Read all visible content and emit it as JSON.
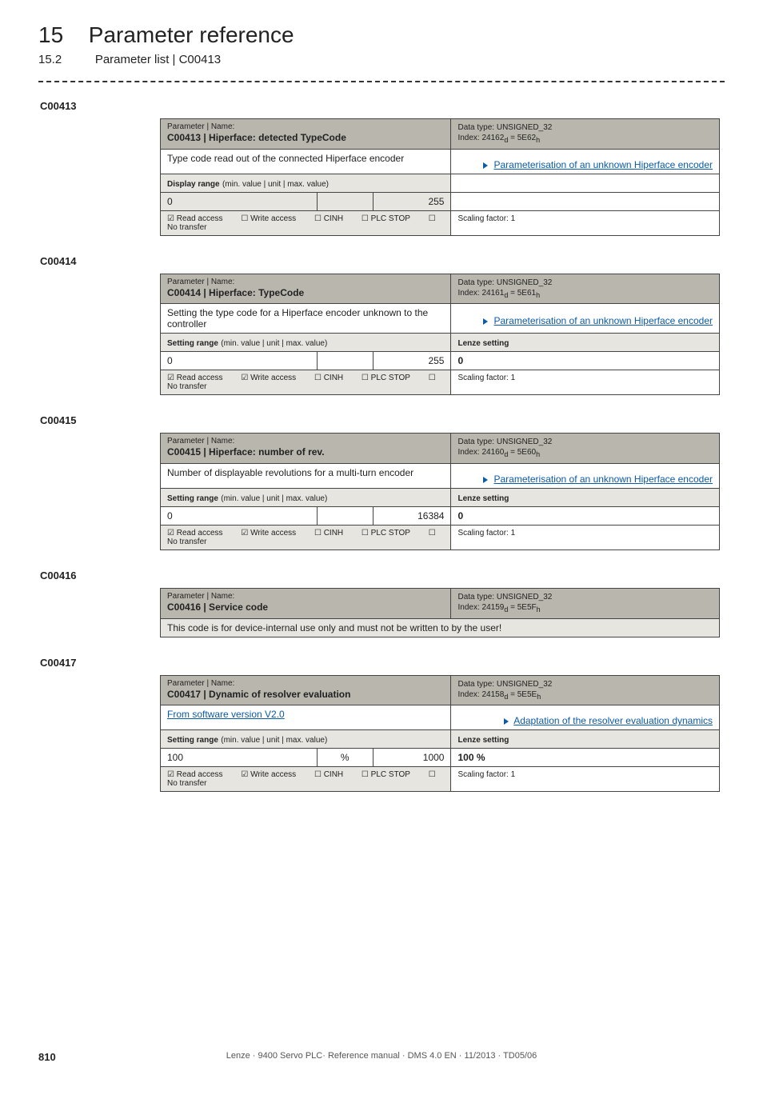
{
  "chapter": {
    "number": "15",
    "title": "Parameter reference"
  },
  "section": {
    "number": "15.2",
    "title": "Parameter list | C00413"
  },
  "labels": {
    "parameter_name": "Parameter | Name:",
    "data_type": "Data type:",
    "index": "Index:",
    "display_range": "Display range",
    "setting_range": "Setting range",
    "range_suffix": "(min. value | unit | max. value)",
    "lenze_setting": "Lenze setting",
    "scaling_factor": "Scaling factor:",
    "read_access": "Read access",
    "write_access": "Write access",
    "cinh": "CINH",
    "plc_stop": "PLC STOP",
    "no_transfer": "No transfer"
  },
  "params": [
    {
      "code": "C00413",
      "title": "C00413 | Hiperface: detected TypeCode",
      "data_type": "UNSIGNED_32",
      "index": "24162",
      "index_hex": "5E62",
      "description": "Type code read out of the connected Hiperface encoder",
      "link_text": "Parameterisation of an unknown Hiperface encoder",
      "range_kind": "display",
      "range": {
        "min": "0",
        "unit": "",
        "max": "255"
      },
      "lenze": null,
      "flags": {
        "read": true,
        "write": false,
        "cinh": false,
        "plc": false,
        "notransfer": false
      },
      "scaling": "1"
    },
    {
      "code": "C00414",
      "title": "C00414 | Hiperface: TypeCode",
      "data_type": "UNSIGNED_32",
      "index": "24161",
      "index_hex": "5E61",
      "description": "Setting the type code for a Hiperface encoder unknown to the controller",
      "link_text": "Parameterisation of an unknown Hiperface encoder",
      "range_kind": "setting",
      "range": {
        "min": "0",
        "unit": "",
        "max": "255"
      },
      "lenze": "0",
      "flags": {
        "read": true,
        "write": true,
        "cinh": false,
        "plc": false,
        "notransfer": false
      },
      "scaling": "1"
    },
    {
      "code": "C00415",
      "title": "C00415 | Hiperface: number of rev.",
      "data_type": "UNSIGNED_32",
      "index": "24160",
      "index_hex": "5E60",
      "description": "Number of displayable revolutions for a multi-turn encoder",
      "link_text": "Parameterisation of an unknown Hiperface encoder",
      "range_kind": "setting",
      "range": {
        "min": "0",
        "unit": "",
        "max": "16384"
      },
      "lenze": "0",
      "flags": {
        "read": true,
        "write": true,
        "cinh": false,
        "plc": false,
        "notransfer": false
      },
      "scaling": "1"
    },
    {
      "code": "C00416",
      "title": "C00416 | Service code",
      "data_type": "UNSIGNED_32",
      "index": "24159",
      "index_hex": "5E5F",
      "important": "This code is for device-internal use only and must not be written to by the user!"
    },
    {
      "code": "C00417",
      "title": "C00417 | Dynamic of resolver evaluation",
      "data_type": "UNSIGNED_32",
      "index": "24158",
      "index_hex": "5E5E",
      "description": "From software version V2.0",
      "description_is_link": true,
      "link_text": "Adaptation of the resolver evaluation dynamics",
      "range_kind": "setting",
      "range": {
        "min": "100",
        "unit": "%",
        "max": "1000"
      },
      "lenze": "100 %",
      "flags": {
        "read": true,
        "write": true,
        "cinh": false,
        "plc": false,
        "notransfer": false
      },
      "scaling": "1"
    }
  ],
  "footer": {
    "page_number": "810",
    "publisher": "Lenze · 9400 Servo PLC· Reference manual · DMS 4.0 EN · 11/2013 · TD05/06"
  }
}
